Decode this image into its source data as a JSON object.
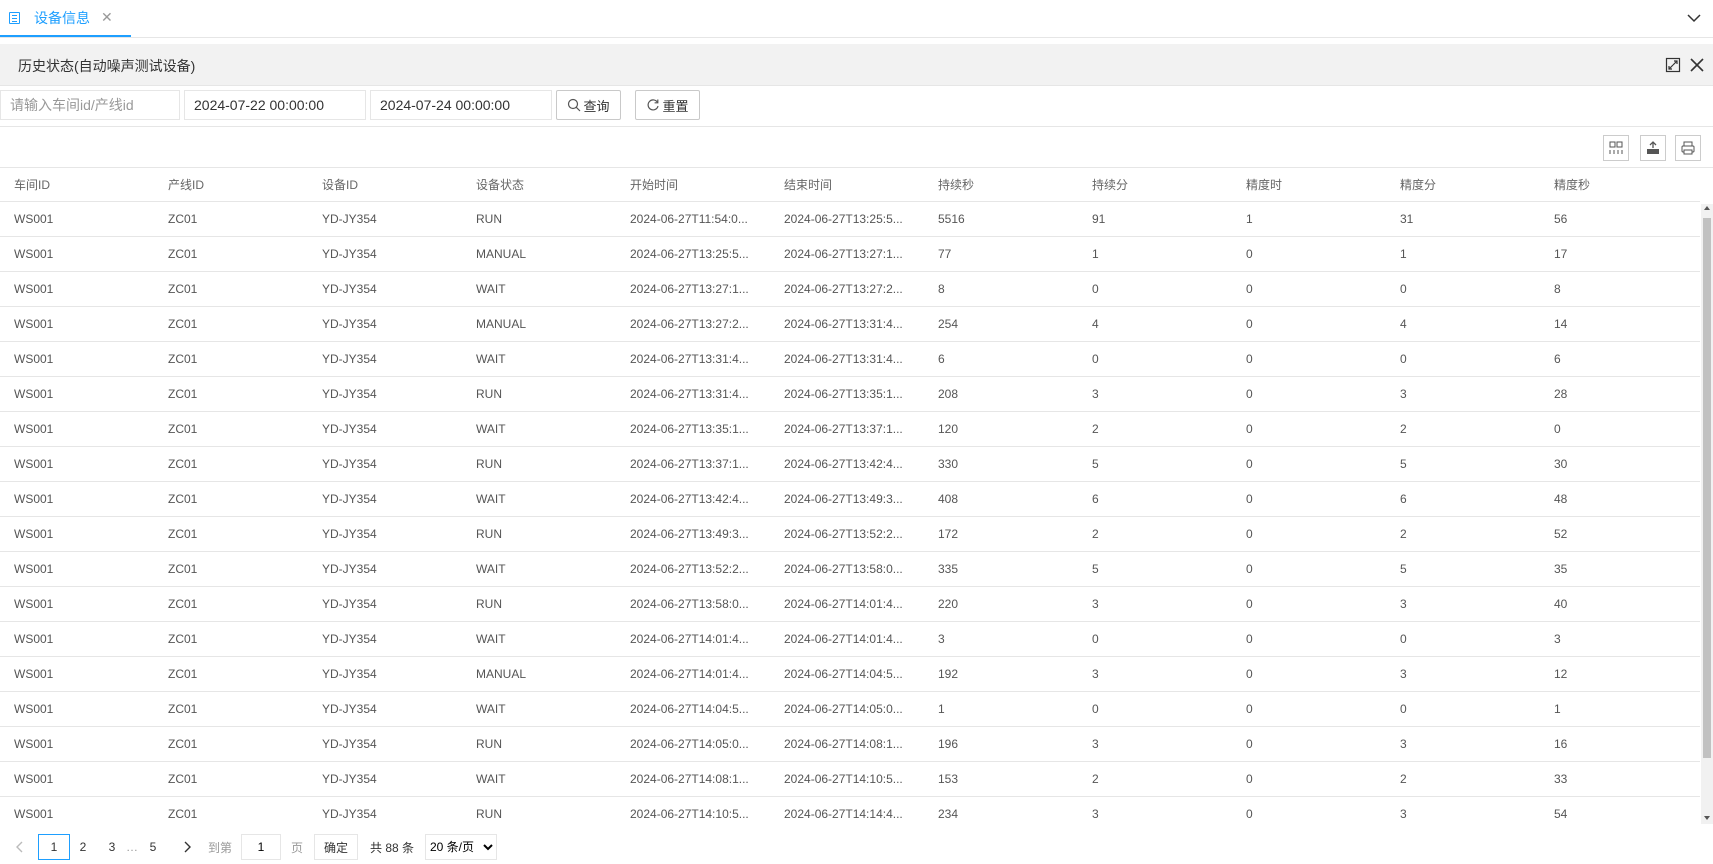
{
  "tabbar": {
    "tab_label": "设备信息",
    "tab_close": "✕"
  },
  "panel": {
    "title": "历史状态(自动噪声测试设备)"
  },
  "search": {
    "id_placeholder": "请输入车间id/产线id",
    "start_time": "2024-07-22 00:00:00",
    "end_time": "2024-07-24 00:00:00",
    "query_label": "查询",
    "reset_label": "重置"
  },
  "table": {
    "headers": [
      "车间ID",
      "产线ID",
      "设备ID",
      "设备状态",
      "开始时间",
      "结束时间",
      "持续秒",
      "持续分",
      "精度时",
      "精度分",
      "精度秒"
    ],
    "rows": [
      [
        "WS001",
        "ZC01",
        "YD-JY354",
        "RUN",
        "2024-06-27T11:54:0...",
        "2024-06-27T13:25:5...",
        "5516",
        "91",
        "1",
        "31",
        "56"
      ],
      [
        "WS001",
        "ZC01",
        "YD-JY354",
        "MANUAL",
        "2024-06-27T13:25:5...",
        "2024-06-27T13:27:1...",
        "77",
        "1",
        "0",
        "1",
        "17"
      ],
      [
        "WS001",
        "ZC01",
        "YD-JY354",
        "WAIT",
        "2024-06-27T13:27:1...",
        "2024-06-27T13:27:2...",
        "8",
        "0",
        "0",
        "0",
        "8"
      ],
      [
        "WS001",
        "ZC01",
        "YD-JY354",
        "MANUAL",
        "2024-06-27T13:27:2...",
        "2024-06-27T13:31:4...",
        "254",
        "4",
        "0",
        "4",
        "14"
      ],
      [
        "WS001",
        "ZC01",
        "YD-JY354",
        "WAIT",
        "2024-06-27T13:31:4...",
        "2024-06-27T13:31:4...",
        "6",
        "0",
        "0",
        "0",
        "6"
      ],
      [
        "WS001",
        "ZC01",
        "YD-JY354",
        "RUN",
        "2024-06-27T13:31:4...",
        "2024-06-27T13:35:1...",
        "208",
        "3",
        "0",
        "3",
        "28"
      ],
      [
        "WS001",
        "ZC01",
        "YD-JY354",
        "WAIT",
        "2024-06-27T13:35:1...",
        "2024-06-27T13:37:1...",
        "120",
        "2",
        "0",
        "2",
        "0"
      ],
      [
        "WS001",
        "ZC01",
        "YD-JY354",
        "RUN",
        "2024-06-27T13:37:1...",
        "2024-06-27T13:42:4...",
        "330",
        "5",
        "0",
        "5",
        "30"
      ],
      [
        "WS001",
        "ZC01",
        "YD-JY354",
        "WAIT",
        "2024-06-27T13:42:4...",
        "2024-06-27T13:49:3...",
        "408",
        "6",
        "0",
        "6",
        "48"
      ],
      [
        "WS001",
        "ZC01",
        "YD-JY354",
        "RUN",
        "2024-06-27T13:49:3...",
        "2024-06-27T13:52:2...",
        "172",
        "2",
        "0",
        "2",
        "52"
      ],
      [
        "WS001",
        "ZC01",
        "YD-JY354",
        "WAIT",
        "2024-06-27T13:52:2...",
        "2024-06-27T13:58:0...",
        "335",
        "5",
        "0",
        "5",
        "35"
      ],
      [
        "WS001",
        "ZC01",
        "YD-JY354",
        "RUN",
        "2024-06-27T13:58:0...",
        "2024-06-27T14:01:4...",
        "220",
        "3",
        "0",
        "3",
        "40"
      ],
      [
        "WS001",
        "ZC01",
        "YD-JY354",
        "WAIT",
        "2024-06-27T14:01:4...",
        "2024-06-27T14:01:4...",
        "3",
        "0",
        "0",
        "0",
        "3"
      ],
      [
        "WS001",
        "ZC01",
        "YD-JY354",
        "MANUAL",
        "2024-06-27T14:01:4...",
        "2024-06-27T14:04:5...",
        "192",
        "3",
        "0",
        "3",
        "12"
      ],
      [
        "WS001",
        "ZC01",
        "YD-JY354",
        "WAIT",
        "2024-06-27T14:04:5...",
        "2024-06-27T14:05:0...",
        "1",
        "0",
        "0",
        "0",
        "1"
      ],
      [
        "WS001",
        "ZC01",
        "YD-JY354",
        "RUN",
        "2024-06-27T14:05:0...",
        "2024-06-27T14:08:1...",
        "196",
        "3",
        "0",
        "3",
        "16"
      ],
      [
        "WS001",
        "ZC01",
        "YD-JY354",
        "WAIT",
        "2024-06-27T14:08:1...",
        "2024-06-27T14:10:5...",
        "153",
        "2",
        "0",
        "2",
        "33"
      ],
      [
        "WS001",
        "ZC01",
        "YD-JY354",
        "RUN",
        "2024-06-27T14:10:5...",
        "2024-06-27T14:14:4...",
        "234",
        "3",
        "0",
        "3",
        "54"
      ]
    ]
  },
  "pager": {
    "pages": [
      "1",
      "2",
      "3"
    ],
    "ellipsis": "…",
    "last_page": "5",
    "goto_label": "到第",
    "goto_value": "1",
    "page_unit": "页",
    "confirm_label": "确定",
    "total_label": "共 88 条",
    "page_size": "20 条/页"
  },
  "icons": {
    "tab": "document-icon",
    "dropdown": "chevron-down-icon",
    "maximize": "maximize-icon",
    "close": "close-icon",
    "query": "search-icon",
    "reset": "refresh-icon",
    "columns": "columns-icon",
    "export": "export-icon",
    "print": "print-icon"
  },
  "colors": {
    "accent": "#1E9FFF",
    "border": "#e6e6e6",
    "header_bg": "#f2f2f2"
  }
}
